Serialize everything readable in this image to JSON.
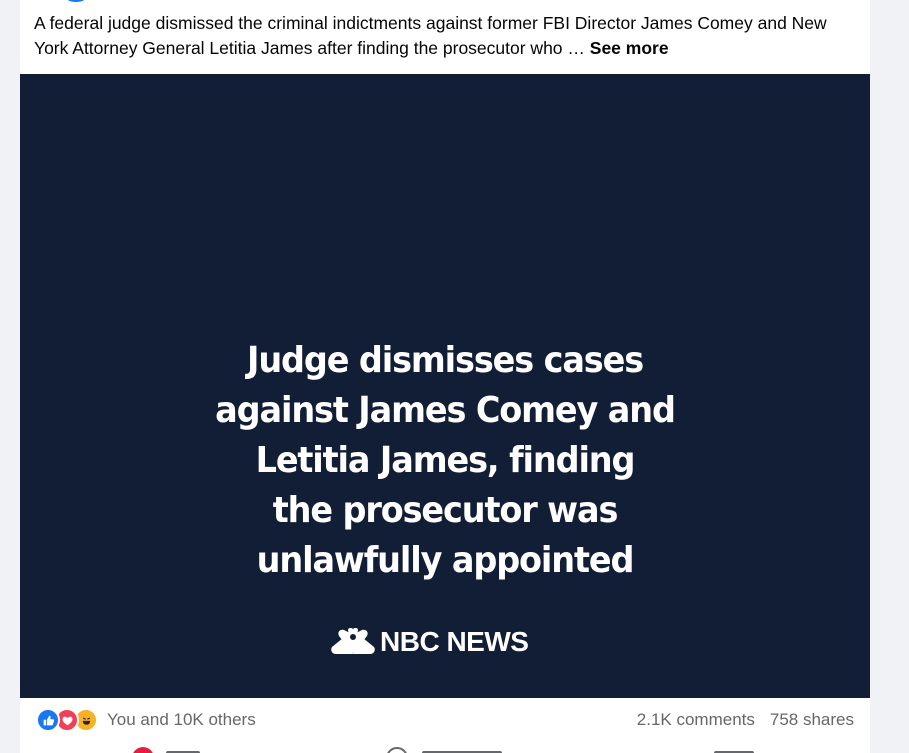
{
  "post": {
    "caption_text": "A federal judge dismissed the criminal indictments against former FBI Director James Comey and New York Attorney General Letitia James after finding the prosecutor who … ",
    "see_more_label": "See more"
  },
  "media": {
    "headline_lines": [
      "Judge dismisses cases",
      "against James Comey and",
      "Letitia James, finding",
      "the prosecutor was",
      "unlawfully appointed"
    ],
    "brand": "NBC NEWS",
    "logo_icon": "nbc-peacock-icon",
    "background_color": "#121e36"
  },
  "stats": {
    "reaction_icons": [
      "like-reaction-icon",
      "love-reaction-icon",
      "haha-reaction-icon"
    ],
    "reactions_text": "You and 10K others",
    "comments": "2.1K comments",
    "shares": "758 shares"
  },
  "colors": {
    "like_blue": "#1877f2",
    "love_red": "#f33e58",
    "haha_yellow": "#f7b125",
    "muted_text": "#65676b"
  }
}
